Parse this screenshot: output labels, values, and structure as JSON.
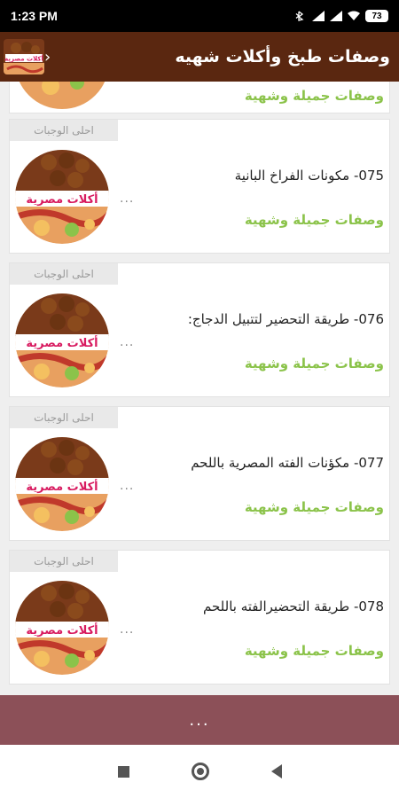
{
  "status_bar": {
    "time": "1:23 PM",
    "battery": "73",
    "icons": [
      "bluetooth-icon",
      "signal-icon",
      "signal-icon",
      "wifi-icon",
      "battery-icon"
    ]
  },
  "app_bar": {
    "title": "وصفات طبخ وأكلات شهيه",
    "logo_text": "أكلات مصرية",
    "back_icon": "chevron-left-icon"
  },
  "list": {
    "partial_item": {
      "subtitle": "وصفات جميلة وشهية"
    },
    "items": [
      {
        "badge": "احلى الوجبات",
        "title": "075- مكونات الفراخ البانية",
        "subtitle": "وصفات جميلة وشهية",
        "dots": "...",
        "thumb_text": "أكلات مصرية"
      },
      {
        "badge": "احلى الوجبات",
        "title": "076- طريقة التحضير لتتبيل الدجاج:",
        "subtitle": "وصفات جميلة وشهية",
        "dots": "...",
        "thumb_text": "أكلات مصرية"
      },
      {
        "badge": "احلى الوجبات",
        "title": "077- مكؤنات الفته المصرية باللحم",
        "subtitle": "وصفات جميلة وشهية",
        "dots": "...",
        "thumb_text": "أكلات مصرية"
      },
      {
        "badge": "احلى الوجبات",
        "title": "078- طريقة التحضيرالفته باللحم",
        "subtitle": "وصفات جميلة وشهية",
        "dots": "...",
        "thumb_text": "أكلات مصرية"
      }
    ]
  },
  "more_button": {
    "label": "..."
  },
  "nav_bar": {
    "icons": [
      "recent-apps-icon",
      "home-icon",
      "back-icon"
    ]
  },
  "colors": {
    "app_bar": "#5a2710",
    "subtitle_green": "#8bc34a",
    "more_bar": "#8c5058",
    "thumb_banner_text": "#d81b60"
  }
}
